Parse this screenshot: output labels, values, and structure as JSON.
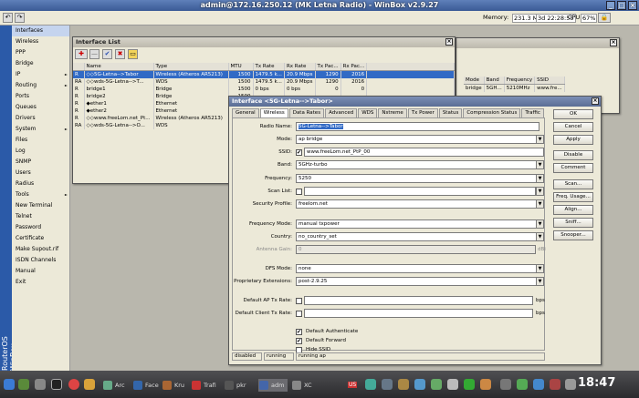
{
  "window": {
    "title": "admin@172.16.250.12 (MK Letna Radio) - WinBox v2.9.27"
  },
  "status": {
    "memory_label": "Memory:",
    "memory": "231.3 MiB",
    "uptime": "3d 22:28:55",
    "cpu_label": "CPU:",
    "cpu": "67%"
  },
  "sidebar": {
    "brand": "RouterOS WinBox"
  },
  "menu": [
    {
      "label": "Interfaces",
      "sub": false
    },
    {
      "label": "Wireless",
      "sub": false
    },
    {
      "label": "PPP",
      "sub": false
    },
    {
      "label": "Bridge",
      "sub": false
    },
    {
      "label": "IP",
      "sub": true
    },
    {
      "label": "Routing",
      "sub": true
    },
    {
      "label": "Ports",
      "sub": false
    },
    {
      "label": "Queues",
      "sub": false
    },
    {
      "label": "Drivers",
      "sub": false
    },
    {
      "label": "System",
      "sub": true
    },
    {
      "label": "Files",
      "sub": false
    },
    {
      "label": "Log",
      "sub": false
    },
    {
      "label": "SNMP",
      "sub": false
    },
    {
      "label": "Users",
      "sub": false
    },
    {
      "label": "Radius",
      "sub": false
    },
    {
      "label": "Tools",
      "sub": true
    },
    {
      "label": "New Terminal",
      "sub": false
    },
    {
      "label": "Telnet",
      "sub": false
    },
    {
      "label": "Password",
      "sub": false
    },
    {
      "label": "Certificate",
      "sub": false
    },
    {
      "label": "Make Supout.rif",
      "sub": false
    },
    {
      "label": "ISDN Channels",
      "sub": false
    },
    {
      "label": "Manual",
      "sub": false
    },
    {
      "label": "Exit",
      "sub": false
    }
  ],
  "iflist": {
    "title": "Interface List",
    "columns": [
      "",
      "Name",
      "Type",
      "MTU",
      "Tx Rate",
      "Rx Rate",
      "Tx Pac...",
      "Rx Pac..."
    ],
    "rows": [
      {
        "flag": "R",
        "name": "◇◇5G-Letna-->Tabor",
        "type": "Wireless (Atheros AR5213)",
        "mtu": "1500",
        "tx": "1479.5 k...",
        "rx": "20.9 Mbps",
        "txp": "1290",
        "rxp": "2016",
        "sel": true
      },
      {
        "flag": "RA",
        "name": "◇◇wds-5G-Letna-->T...",
        "type": "WDS",
        "mtu": "1500",
        "tx": "1479.5 k...",
        "rx": "20.9 Mbps",
        "txp": "1290",
        "rxp": "2016",
        "sel": false
      },
      {
        "flag": "R",
        "name": "bridge1",
        "type": "Bridge",
        "mtu": "1500",
        "tx": "0 bps",
        "rx": "0 bps",
        "txp": "0",
        "rxp": "0",
        "sel": false
      },
      {
        "flag": "R",
        "name": "bridge2",
        "type": "Bridge",
        "mtu": "1500",
        "tx": "",
        "rx": "",
        "txp": "",
        "rxp": "",
        "sel": false
      },
      {
        "flag": "R",
        "name": "◆ether1",
        "type": "Ethernet",
        "mtu": "1500",
        "tx": "",
        "rx": "",
        "txp": "",
        "rxp": "",
        "sel": false
      },
      {
        "flag": "R",
        "name": "◆ether2",
        "type": "Ethernet",
        "mtu": "1500",
        "tx": "",
        "rx": "",
        "txp": "",
        "rxp": "",
        "sel": false
      },
      {
        "flag": "R",
        "name": "◇◇www.freeLom.net_Pt...",
        "type": "Wireless (Atheros AR5213)",
        "mtu": "1500",
        "tx": "",
        "rx": "",
        "txp": "",
        "rxp": "",
        "sel": false
      },
      {
        "flag": "RA",
        "name": "◇◇wds-5G-Letna-->O...",
        "type": "WDS",
        "mtu": "1500",
        "tx": "",
        "rx": "",
        "txp": "",
        "rxp": "",
        "sel": false
      }
    ]
  },
  "backwin": {
    "columns": [
      "Mode",
      "Band",
      "Frequency",
      "SSID"
    ],
    "row": [
      "bridge",
      "5GH...",
      "5210MHz",
      "www.fre..."
    ]
  },
  "dialog": {
    "title": "Interface <5G-Letna-->Tabor>",
    "tabs": [
      "General",
      "Wireless",
      "Data Rates",
      "Advanced",
      "WDS",
      "Nstreme",
      "Tx Power",
      "Status",
      "Compression Status",
      "Traffic"
    ],
    "fields": {
      "radio_name": {
        "label": "Radio Name:",
        "value": "5G-Letna-->Tabor"
      },
      "mode": {
        "label": "Mode:",
        "value": "ap bridge"
      },
      "ssid": {
        "label": "SSID:",
        "value": "www.freeLom.net_PtP_00"
      },
      "band": {
        "label": "Band:",
        "value": "5GHz-turbo"
      },
      "frequency": {
        "label": "Frequency:",
        "value": "5250"
      },
      "scan_list": {
        "label": "Scan List:",
        "value": ""
      },
      "security_profile": {
        "label": "Security Profile:",
        "value": "freelom.net"
      },
      "frequency_mode": {
        "label": "Frequency Mode:",
        "value": "manual txpower"
      },
      "country": {
        "label": "Country:",
        "value": "no_country_set"
      },
      "antenna_gain": {
        "label": "Antenna Gain:",
        "value": "0",
        "unit": "dBi"
      },
      "dfs_mode": {
        "label": "DFS Mode:",
        "value": "none"
      },
      "proprietary_ext": {
        "label": "Proprietary Extensions:",
        "value": "post-2.9.25"
      },
      "default_ap_tx": {
        "label": "Default AP Tx Rate:",
        "value": "",
        "unit": "bps"
      },
      "default_client_tx": {
        "label": "Default Client Tx Rate:",
        "value": "",
        "unit": "bps"
      }
    },
    "checks": [
      {
        "label": "Default Authenticate",
        "checked": true
      },
      {
        "label": "Default Forward",
        "checked": true
      },
      {
        "label": "Hide SSID",
        "checked": false
      }
    ],
    "buttons": [
      "OK",
      "Cancel",
      "Apply",
      "Disable",
      "Comment",
      "Scan...",
      "Freq. Usage...",
      "Align...",
      "Sniff...",
      "Snooper..."
    ],
    "statusbar": [
      "disabled",
      "running",
      "running ap"
    ]
  },
  "taskbar": {
    "tasks": [
      "Arc",
      "Face",
      "Kru",
      "Trafi",
      "pkr",
      "adm",
      "XC"
    ],
    "lang": "US",
    "clock": "18:47"
  },
  "colors": {
    "accent": "#2b5aa8",
    "selection": "#316ac5"
  }
}
